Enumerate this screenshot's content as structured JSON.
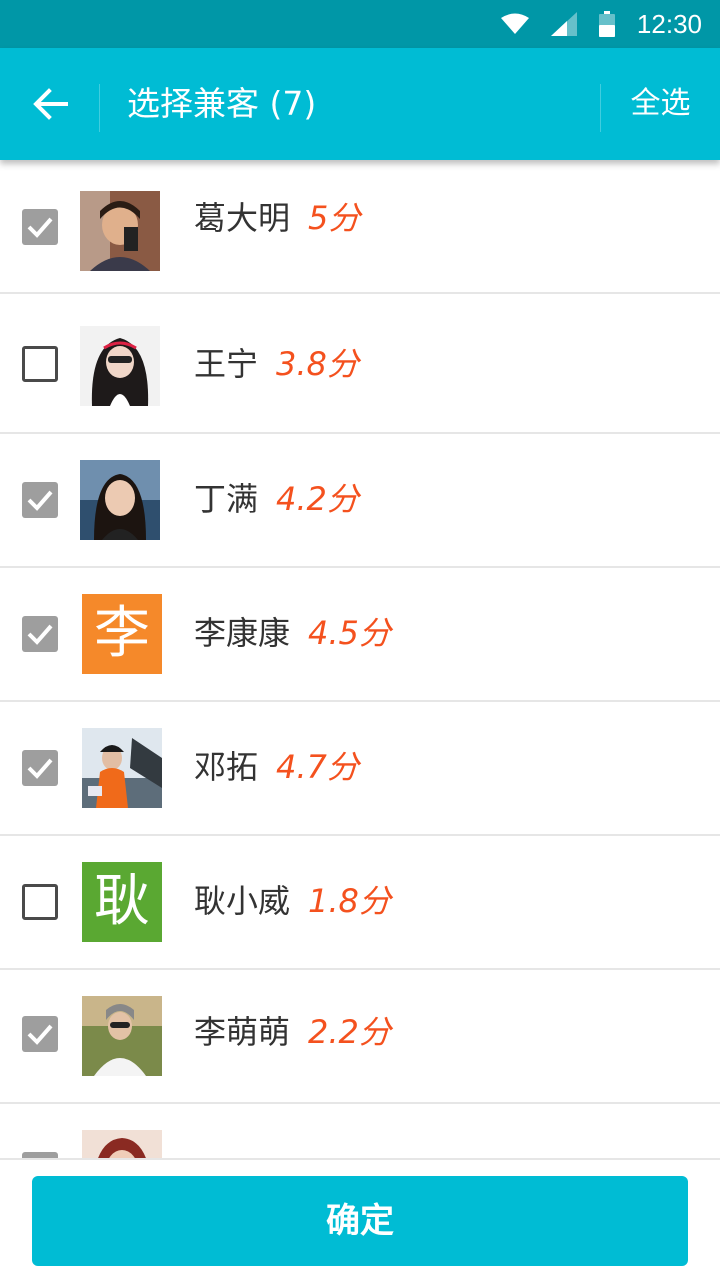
{
  "status_bar": {
    "time": "12:30"
  },
  "app_bar": {
    "title": "选择兼客 (7)",
    "select_all": "全选"
  },
  "list": [
    {
      "name": "葛大明",
      "score": "5分",
      "checked": true,
      "avatar": {
        "type": "photo"
      }
    },
    {
      "name": "王宁",
      "score": "3.8分",
      "checked": false,
      "avatar": {
        "type": "photo"
      }
    },
    {
      "name": "丁满",
      "score": "4.2分",
      "checked": true,
      "avatar": {
        "type": "photo"
      }
    },
    {
      "name": "李康康",
      "score": "4.5分",
      "checked": true,
      "avatar": {
        "type": "letter",
        "letter": "李",
        "color": "#f5892a"
      }
    },
    {
      "name": "邓拓",
      "score": "4.7分",
      "checked": true,
      "avatar": {
        "type": "photo"
      }
    },
    {
      "name": "耿小威",
      "score": "1.8分",
      "checked": false,
      "avatar": {
        "type": "letter",
        "letter": "耿",
        "color": "#5aa832"
      }
    },
    {
      "name": "李萌萌",
      "score": "2.2分",
      "checked": true,
      "avatar": {
        "type": "photo"
      }
    },
    {
      "name": "",
      "score": "",
      "checked": true,
      "avatar": {
        "type": "photo"
      }
    }
  ],
  "footer": {
    "confirm": "确定"
  },
  "colors": {
    "status_bar": "#0097a7",
    "app_bar": "#00bcd4",
    "score": "#f4511e",
    "checkbox_checked": "#9e9e9e"
  }
}
